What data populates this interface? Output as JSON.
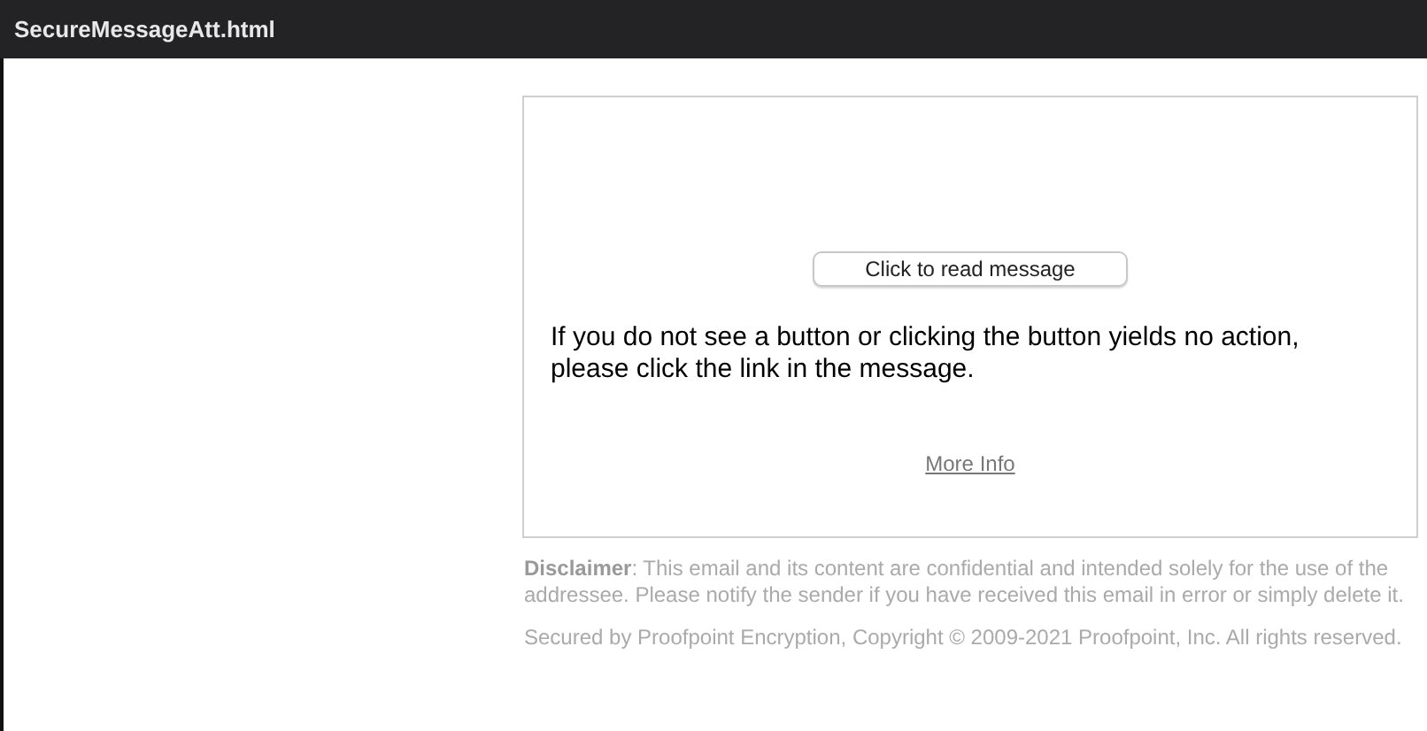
{
  "window": {
    "title": "SecureMessageAtt.html"
  },
  "card": {
    "button": "Click to read message",
    "message": "If you do not see a button or clicking the button yields no action, please click the link in the message.",
    "link": "More Info"
  },
  "footer": {
    "disclaimer": "**Disclaimer**:  This email and its content are confidential and intended solely for the use of the addressee. Please notify the sender if you have received this email in error or simply delete it.",
    "copyright": "Secured by Proofpoint Encryption, Copyright © 2009-2021 Proofpoint, Inc. All rights reserved."
  }
}
